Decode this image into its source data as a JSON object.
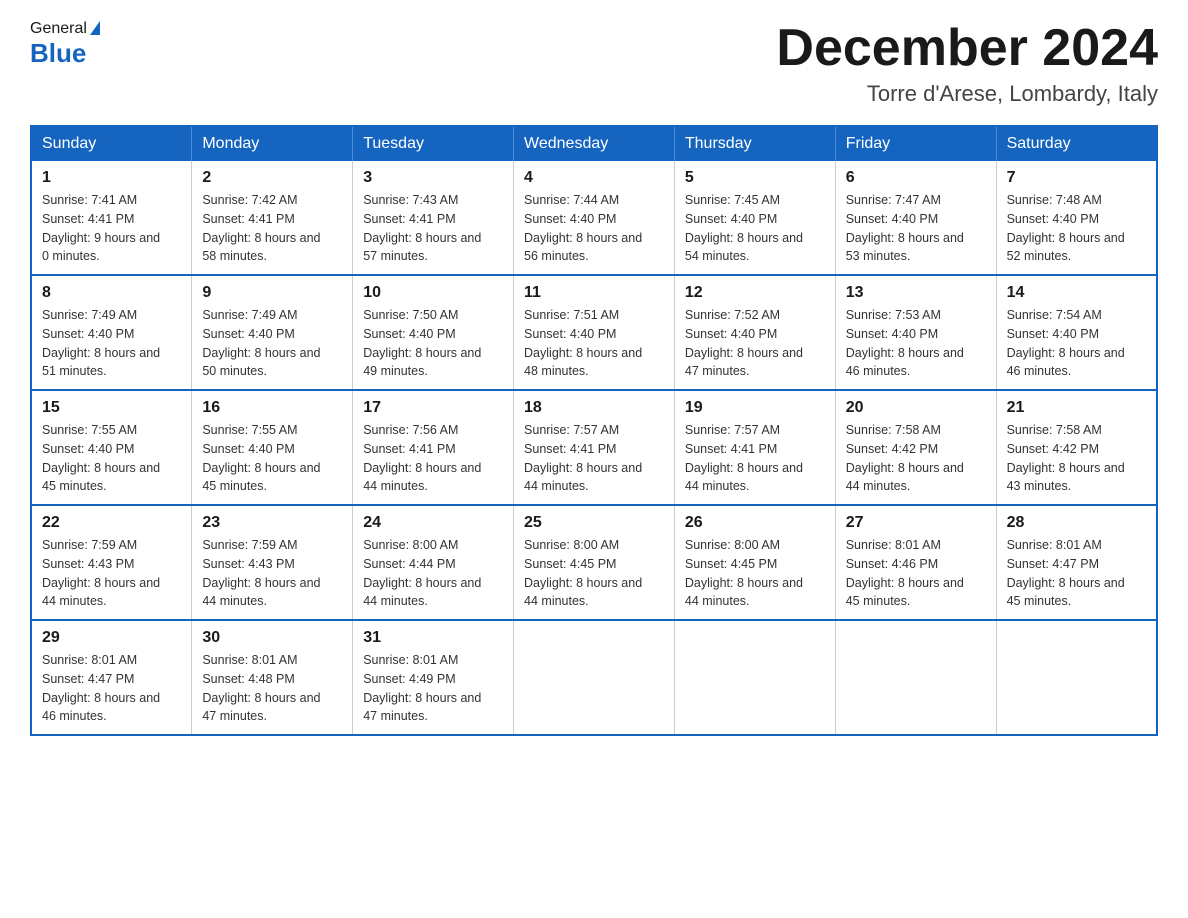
{
  "logo": {
    "general": "General",
    "triangle": "▲",
    "blue": "Blue"
  },
  "title": "December 2024",
  "location": "Torre d'Arese, Lombardy, Italy",
  "days_of_week": [
    "Sunday",
    "Monday",
    "Tuesday",
    "Wednesday",
    "Thursday",
    "Friday",
    "Saturday"
  ],
  "weeks": [
    [
      {
        "day": "1",
        "sunrise": "7:41 AM",
        "sunset": "4:41 PM",
        "daylight": "9 hours and 0 minutes."
      },
      {
        "day": "2",
        "sunrise": "7:42 AM",
        "sunset": "4:41 PM",
        "daylight": "8 hours and 58 minutes."
      },
      {
        "day": "3",
        "sunrise": "7:43 AM",
        "sunset": "4:41 PM",
        "daylight": "8 hours and 57 minutes."
      },
      {
        "day": "4",
        "sunrise": "7:44 AM",
        "sunset": "4:40 PM",
        "daylight": "8 hours and 56 minutes."
      },
      {
        "day": "5",
        "sunrise": "7:45 AM",
        "sunset": "4:40 PM",
        "daylight": "8 hours and 54 minutes."
      },
      {
        "day": "6",
        "sunrise": "7:47 AM",
        "sunset": "4:40 PM",
        "daylight": "8 hours and 53 minutes."
      },
      {
        "day": "7",
        "sunrise": "7:48 AM",
        "sunset": "4:40 PM",
        "daylight": "8 hours and 52 minutes."
      }
    ],
    [
      {
        "day": "8",
        "sunrise": "7:49 AM",
        "sunset": "4:40 PM",
        "daylight": "8 hours and 51 minutes."
      },
      {
        "day": "9",
        "sunrise": "7:49 AM",
        "sunset": "4:40 PM",
        "daylight": "8 hours and 50 minutes."
      },
      {
        "day": "10",
        "sunrise": "7:50 AM",
        "sunset": "4:40 PM",
        "daylight": "8 hours and 49 minutes."
      },
      {
        "day": "11",
        "sunrise": "7:51 AM",
        "sunset": "4:40 PM",
        "daylight": "8 hours and 48 minutes."
      },
      {
        "day": "12",
        "sunrise": "7:52 AM",
        "sunset": "4:40 PM",
        "daylight": "8 hours and 47 minutes."
      },
      {
        "day": "13",
        "sunrise": "7:53 AM",
        "sunset": "4:40 PM",
        "daylight": "8 hours and 46 minutes."
      },
      {
        "day": "14",
        "sunrise": "7:54 AM",
        "sunset": "4:40 PM",
        "daylight": "8 hours and 46 minutes."
      }
    ],
    [
      {
        "day": "15",
        "sunrise": "7:55 AM",
        "sunset": "4:40 PM",
        "daylight": "8 hours and 45 minutes."
      },
      {
        "day": "16",
        "sunrise": "7:55 AM",
        "sunset": "4:40 PM",
        "daylight": "8 hours and 45 minutes."
      },
      {
        "day": "17",
        "sunrise": "7:56 AM",
        "sunset": "4:41 PM",
        "daylight": "8 hours and 44 minutes."
      },
      {
        "day": "18",
        "sunrise": "7:57 AM",
        "sunset": "4:41 PM",
        "daylight": "8 hours and 44 minutes."
      },
      {
        "day": "19",
        "sunrise": "7:57 AM",
        "sunset": "4:41 PM",
        "daylight": "8 hours and 44 minutes."
      },
      {
        "day": "20",
        "sunrise": "7:58 AM",
        "sunset": "4:42 PM",
        "daylight": "8 hours and 44 minutes."
      },
      {
        "day": "21",
        "sunrise": "7:58 AM",
        "sunset": "4:42 PM",
        "daylight": "8 hours and 43 minutes."
      }
    ],
    [
      {
        "day": "22",
        "sunrise": "7:59 AM",
        "sunset": "4:43 PM",
        "daylight": "8 hours and 44 minutes."
      },
      {
        "day": "23",
        "sunrise": "7:59 AM",
        "sunset": "4:43 PM",
        "daylight": "8 hours and 44 minutes."
      },
      {
        "day": "24",
        "sunrise": "8:00 AM",
        "sunset": "4:44 PM",
        "daylight": "8 hours and 44 minutes."
      },
      {
        "day": "25",
        "sunrise": "8:00 AM",
        "sunset": "4:45 PM",
        "daylight": "8 hours and 44 minutes."
      },
      {
        "day": "26",
        "sunrise": "8:00 AM",
        "sunset": "4:45 PM",
        "daylight": "8 hours and 44 minutes."
      },
      {
        "day": "27",
        "sunrise": "8:01 AM",
        "sunset": "4:46 PM",
        "daylight": "8 hours and 45 minutes."
      },
      {
        "day": "28",
        "sunrise": "8:01 AM",
        "sunset": "4:47 PM",
        "daylight": "8 hours and 45 minutes."
      }
    ],
    [
      {
        "day": "29",
        "sunrise": "8:01 AM",
        "sunset": "4:47 PM",
        "daylight": "8 hours and 46 minutes."
      },
      {
        "day": "30",
        "sunrise": "8:01 AM",
        "sunset": "4:48 PM",
        "daylight": "8 hours and 47 minutes."
      },
      {
        "day": "31",
        "sunrise": "8:01 AM",
        "sunset": "4:49 PM",
        "daylight": "8 hours and 47 minutes."
      },
      null,
      null,
      null,
      null
    ]
  ]
}
